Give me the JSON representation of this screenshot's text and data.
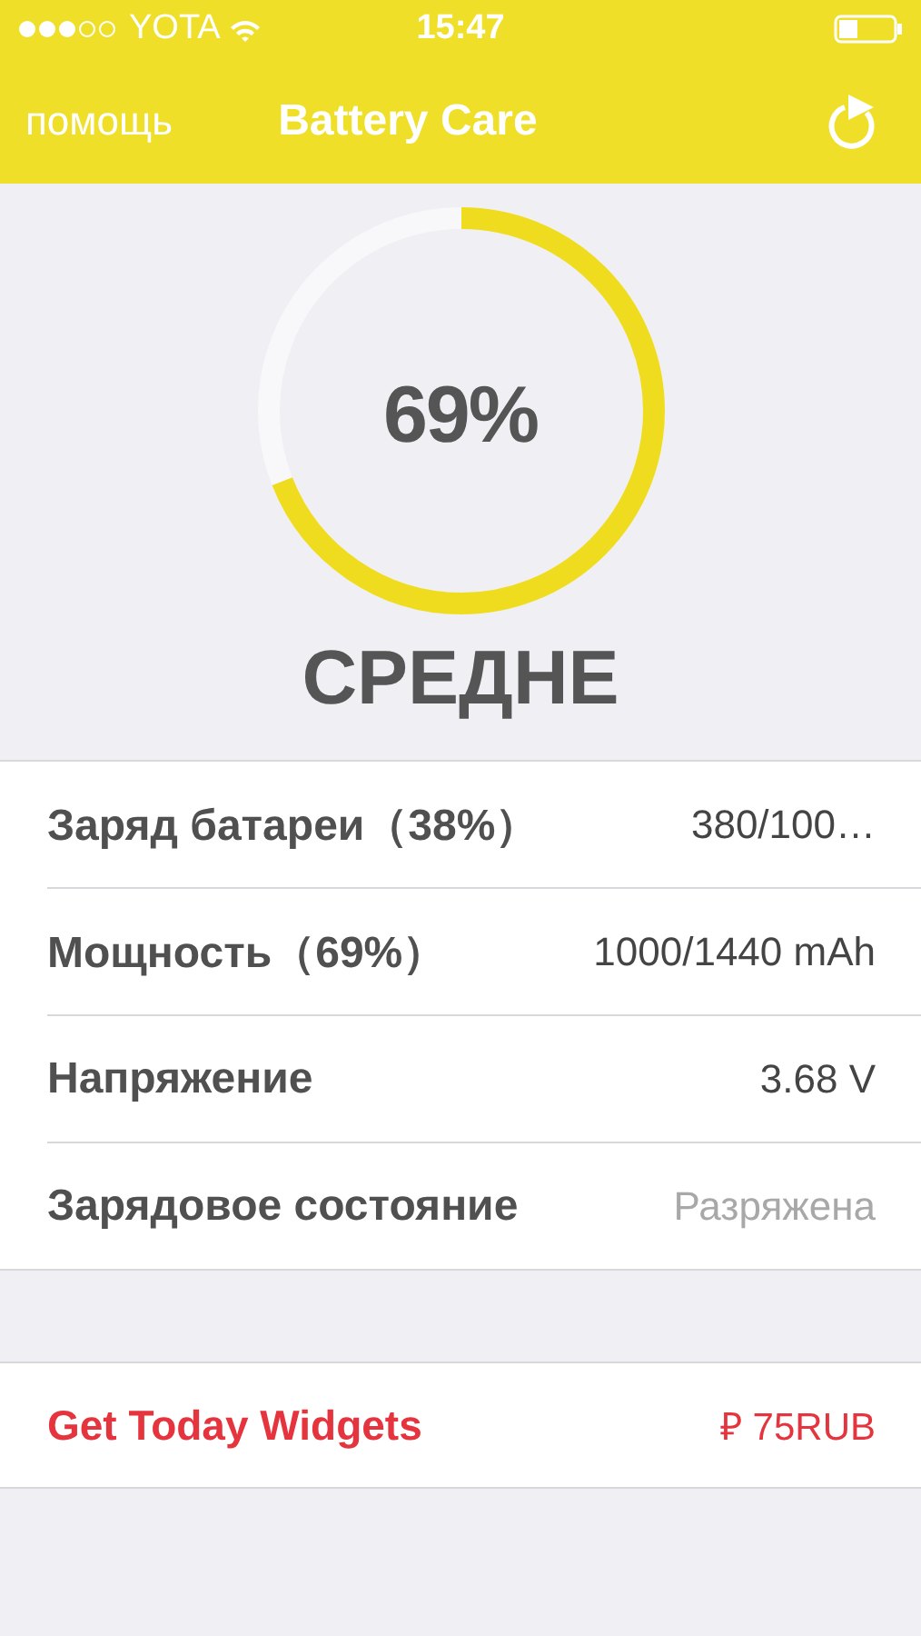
{
  "status_bar": {
    "carrier": "YOTA",
    "time": "15:47"
  },
  "nav": {
    "left": "помощь",
    "title": "Battery Care"
  },
  "gauge": {
    "level": 0.69,
    "reading": "69%",
    "status": "СРЕДНЕ"
  },
  "rows": [
    {
      "label": "Заряд батареи（38%）",
      "value": "380/100…",
      "dimmed": false
    },
    {
      "label": "Мощность（69%）",
      "value": "1000/1440 mAh",
      "dimmed": false
    },
    {
      "label": "Напряжение",
      "value": "3.68 V",
      "dimmed": false
    },
    {
      "label": "Зарядовое состояние",
      "value": "Разряжена",
      "dimmed": true
    }
  ],
  "promo": {
    "label": "Get Today Widgets",
    "price": "₽ 75RUB"
  }
}
